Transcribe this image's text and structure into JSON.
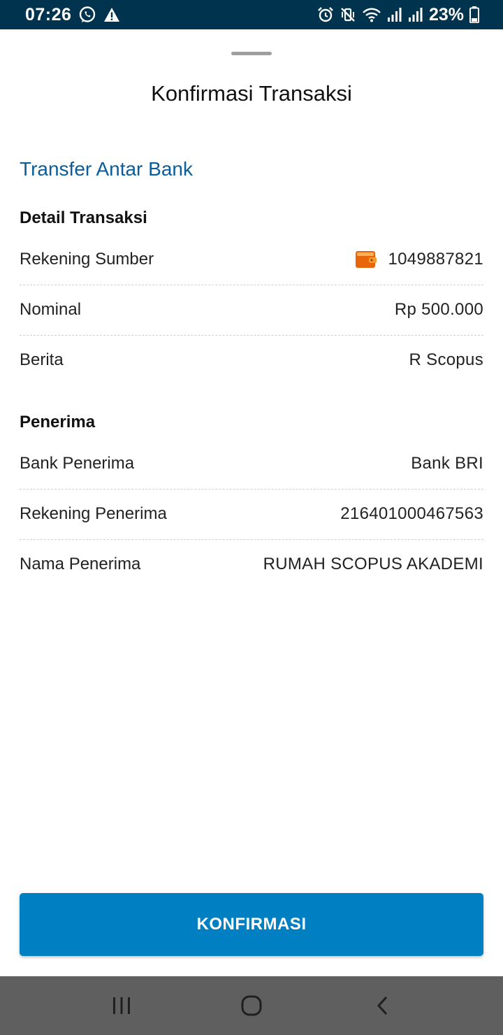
{
  "status_bar": {
    "time": "07:26",
    "battery": "23%",
    "background": "#00334e",
    "left_icons": [
      "whatsapp-icon",
      "warning-icon"
    ],
    "right_icons": [
      "alarm-icon",
      "vibrate-icon",
      "wifi-icon",
      "signal-icon",
      "signal-icon",
      "battery-icon"
    ]
  },
  "sheet": {
    "title": "Konfirmasi Transaksi",
    "transfer_type": "Transfer Antar Bank",
    "accent_color": "#0a5c9a"
  },
  "transaction_details": {
    "heading": "Detail Transaksi",
    "rows": [
      {
        "label": "Rekening Sumber",
        "value": "1049887821",
        "icon": "wallet-icon"
      },
      {
        "label": "Nominal",
        "value": "Rp 500.000"
      },
      {
        "label": "Berita",
        "value": "R Scopus"
      }
    ]
  },
  "recipient": {
    "heading": "Penerima",
    "rows": [
      {
        "label": "Bank Penerima",
        "value": "Bank BRI"
      },
      {
        "label": "Rekening Penerima",
        "value": "216401000467563"
      },
      {
        "label": "Nama Penerima",
        "value": "RUMAH SCOPUS AKADEMI"
      }
    ]
  },
  "confirm_button": {
    "label": "KONFIRMASI",
    "color": "#0080c3"
  },
  "nav_bar": {
    "buttons": [
      "recent-apps-icon",
      "home-icon",
      "back-icon"
    ]
  }
}
